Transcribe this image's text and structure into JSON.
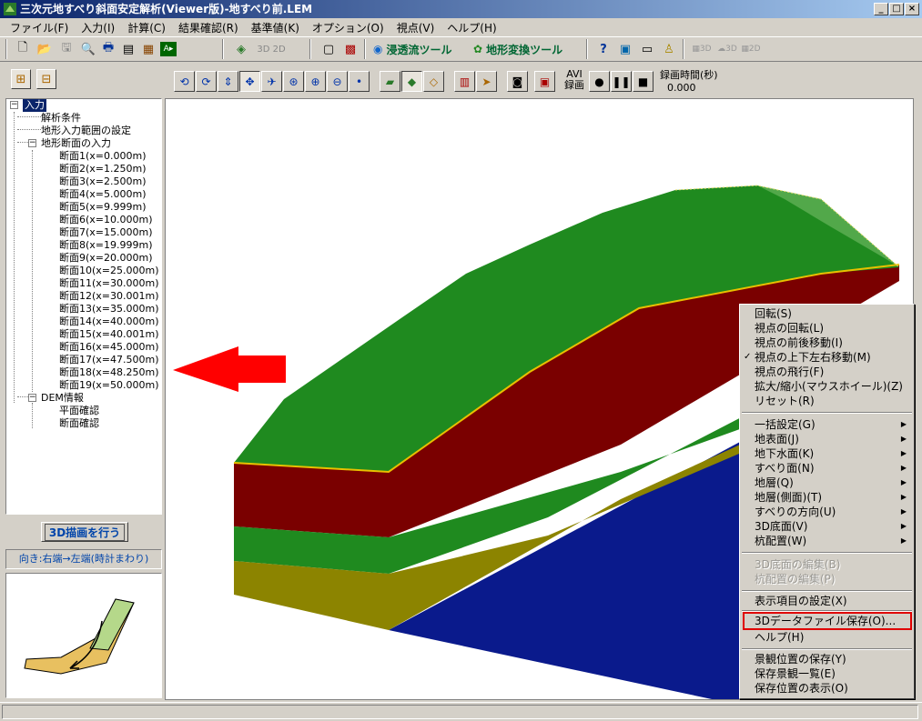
{
  "window": {
    "title": "三次元地すべり斜面安定解析(Viewer版)-地すべり前.LEM"
  },
  "menu": [
    "ファイル(F)",
    "入力(I)",
    "計算(C)",
    "結果確認(R)",
    "基準値(K)",
    "オプション(O)",
    "視点(V)",
    "ヘルプ(H)"
  ],
  "toolbar": {
    "seepage_tool": "浸透流ツール",
    "terrain_tool": "地形変換ツール",
    "avi_label_1": "AVI",
    "avi_label_2": "録画"
  },
  "viewer_toolbar": {
    "rec_time_label": "録画時間(秒)",
    "rec_time_value": "0.000"
  },
  "tree": {
    "root": "入力",
    "items": [
      "解析条件",
      "地形入力範囲の設定",
      "地形断面の入力",
      "断面1(x=0.000m)",
      "断面2(x=1.250m)",
      "断面3(x=2.500m)",
      "断面4(x=5.000m)",
      "断面5(x=9.999m)",
      "断面6(x=10.000m)",
      "断面7(x=15.000m)",
      "断面8(x=19.999m)",
      "断面9(x=20.000m)",
      "断面10(x=25.000m)",
      "断面11(x=30.000m)",
      "断面12(x=30.001m)",
      "断面13(x=35.000m)",
      "断面14(x=40.000m)",
      "断面15(x=40.001m)",
      "断面16(x=45.000m)",
      "断面17(x=47.500m)",
      "断面18(x=48.250m)",
      "断面19(x=50.000m)",
      "DEM情報",
      "平面確認",
      "断面確認"
    ]
  },
  "left_panel": {
    "draw_3d_button": "3D描画を行う",
    "direction_label": "向き:右端→左端(時計まわり)"
  },
  "context_menu": {
    "group1": [
      "回転(S)",
      "視点の回転(L)",
      "視点の前後移動(I)",
      "視点の上下左右移動(M)",
      "視点の飛行(F)",
      "拡大/縮小(マウスホイール)(Z)",
      "リセット(R)"
    ],
    "group2": [
      "一括設定(G)",
      "地表面(J)",
      "地下水面(K)",
      "すべり面(N)",
      "地層(Q)",
      "地層(側面)(T)",
      "すべりの方向(U)",
      "3D底面(V)",
      "杭配置(W)"
    ],
    "group3": [
      "3D底面の編集(B)",
      "杭配置の編集(P)"
    ],
    "group4": [
      "表示項目の設定(X)"
    ],
    "group5": [
      "3Dデータファイル保存(O)...",
      "ヘルプ(H)"
    ],
    "group6": [
      "景観位置の保存(Y)",
      "保存景観一覧(E)",
      "保存位置の表示(O)"
    ]
  },
  "colors": {
    "title_bar": "#0a246a",
    "highlight_box": "#e00000",
    "surface_green": "#1f8a1f",
    "layer_red": "#7a0000",
    "layer_olive": "#8c8400",
    "layer_blue": "#0a1a8c"
  }
}
